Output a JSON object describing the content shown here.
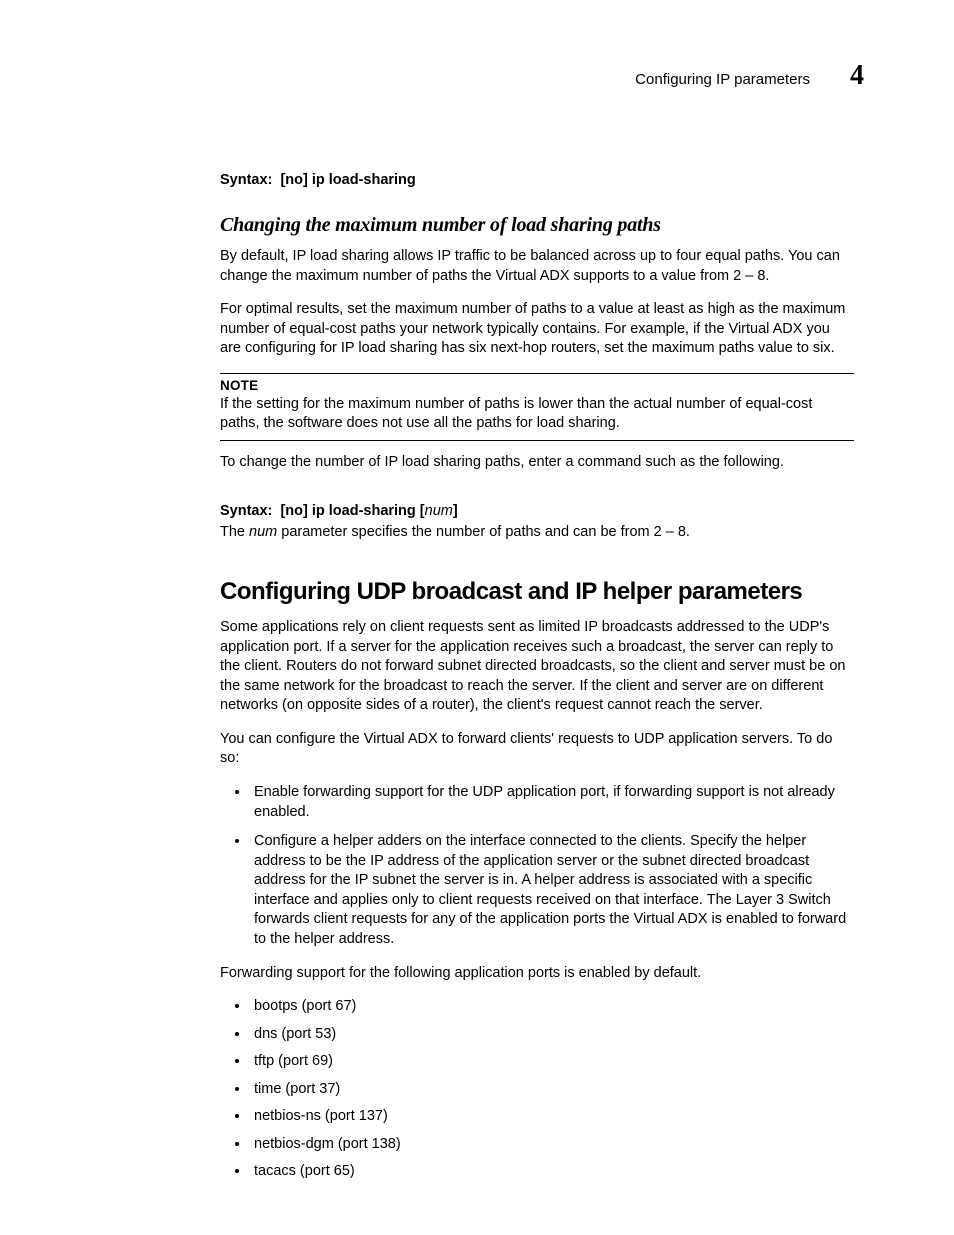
{
  "header": {
    "running_title": "Configuring IP parameters",
    "chapter_number": "4"
  },
  "syntax1": {
    "label": "Syntax:",
    "command": "[no] ip load-sharing"
  },
  "subheading1": "Changing the maximum number of load sharing paths",
  "para1": "By default, IP load sharing allows IP traffic to be balanced across up to four equal paths. You can change the maximum number of paths the Virtual ADX supports to a value from 2 – 8.",
  "para2": "For optimal results, set the maximum number of paths to a value at least as high as the maximum number of equal-cost paths your network typically contains. For example, if the Virtual ADX you are configuring for IP load sharing has six next-hop routers, set the maximum paths value to six.",
  "note": {
    "label": "NOTE",
    "text": "If the setting for the maximum number of paths is lower than the actual number of equal-cost paths, the software does not use all the paths for load sharing."
  },
  "para3": "To change the number of IP load sharing paths, enter a command such as the following.",
  "syntax2": {
    "label": "Syntax:",
    "command_prefix": "[no] ip load-sharing [",
    "param": "num",
    "command_suffix": "]"
  },
  "param_desc": {
    "pre": "The ",
    "param": "num",
    "post": " parameter specifies the number of paths and can be from 2 – 8."
  },
  "section_heading": "Configuring UDP broadcast and IP helper parameters",
  "para4": "Some applications rely on client requests sent as limited IP broadcasts addressed to the UDP's application port. If a server for the application receives such a broadcast, the server can reply to the client. Routers do not forward subnet directed broadcasts, so the client and server must be on the same network for the broadcast to reach the server. If the client and server are on different networks (on opposite sides of a router), the client's request cannot reach the server.",
  "para5": "You can configure the Virtual ADX to forward clients' requests to UDP application servers. To do so:",
  "bullets1": [
    "Enable forwarding support for the UDP application port, if forwarding support is not already enabled.",
    "Configure a helper adders on the interface connected to the clients. Specify the helper address to be the IP address of the application server or the subnet directed broadcast address for the IP subnet the server is in. A helper address is associated with a specific interface and applies only to client requests received on that interface. The Layer 3 Switch forwards client requests for any of the application ports the Virtual ADX is enabled to forward to the helper address."
  ],
  "para6": "Forwarding support for the following application ports is enabled by default.",
  "bullets2": [
    "bootps (port 67)",
    "dns (port 53)",
    "tftp (port 69)",
    "time (port 37)",
    "netbios-ns (port 137)",
    "netbios-dgm (port 138)",
    "tacacs (port 65)"
  ]
}
